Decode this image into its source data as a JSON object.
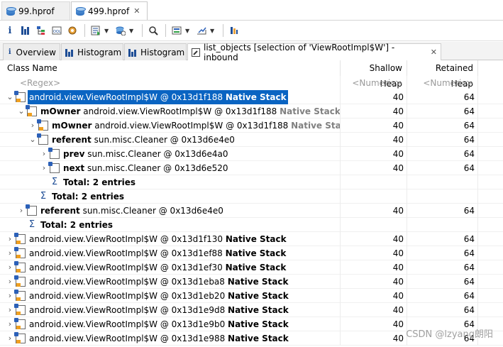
{
  "editor_tabs": [
    {
      "label": "99.hprof",
      "icon": "heap-dump-icon"
    },
    {
      "label": "499.hprof",
      "icon": "heap-dump-icon",
      "close": "✕"
    }
  ],
  "view_tabs": [
    {
      "label": "Overview",
      "icon": "info-icon"
    },
    {
      "label": "Histogram",
      "icon": "histogram-icon"
    },
    {
      "label": "Histogram",
      "icon": "histogram-icon"
    },
    {
      "label": "list_objects [selection of 'ViewRootImpl$W'] -inbound",
      "icon": "query-icon",
      "close": "✕"
    }
  ],
  "table": {
    "headers": {
      "name": "Class Name",
      "shallow": "Shallow Heap",
      "retained": "Retained Heap"
    },
    "filters": {
      "name": "<Regex>",
      "shallow": "<Numeric>",
      "retained": "<Numeric>"
    },
    "rows": [
      {
        "indent": 0,
        "twisty": "⌄",
        "icon": "object",
        "field": "",
        "cls": "android.view.ViewRootImpl$W @ 0x13d1f188",
        "native": "Native Stack",
        "shallow": "40",
        "retained": "64",
        "selected": true
      },
      {
        "indent": 1,
        "twisty": "⌄",
        "icon": "object",
        "field": "mOwner",
        "cls": "android.view.ViewRootImpl$W @ 0x13d1f188",
        "native": "Native Stack",
        "shallow": "40",
        "retained": "64"
      },
      {
        "indent": 2,
        "twisty": "›",
        "icon": "object",
        "field": "mOwner",
        "cls": "android.view.ViewRootImpl$W @ 0x13d1f188",
        "native": "Native Stack",
        "shallow": "40",
        "retained": "64"
      },
      {
        "indent": 2,
        "twisty": "⌄",
        "icon": "object",
        "field": "referent",
        "cls": "sun.misc.Cleaner @ 0x13d6e4e0",
        "native": "",
        "shallow": "40",
        "retained": "64"
      },
      {
        "indent": 3,
        "twisty": "›",
        "icon": "object",
        "field": "prev",
        "cls": "sun.misc.Cleaner @ 0x13d6e4a0",
        "native": "",
        "shallow": "40",
        "retained": "64"
      },
      {
        "indent": 3,
        "twisty": "›",
        "icon": "object",
        "field": "next",
        "cls": "sun.misc.Cleaner @ 0x13d6e520",
        "native": "",
        "shallow": "40",
        "retained": "64"
      },
      {
        "indent": 3,
        "twisty": "",
        "icon": "sigma",
        "field": "Total: 2 entries",
        "cls": "",
        "native": "",
        "shallow": "",
        "retained": ""
      },
      {
        "indent": 2,
        "twisty": "",
        "icon": "sigma",
        "field": "Total: 2 entries",
        "cls": "",
        "native": "",
        "shallow": "",
        "retained": ""
      },
      {
        "indent": 1,
        "twisty": "›",
        "icon": "object",
        "field": "referent",
        "cls": "sun.misc.Cleaner @ 0x13d6e4e0",
        "native": "",
        "shallow": "40",
        "retained": "64"
      },
      {
        "indent": 1,
        "twisty": "",
        "icon": "sigma",
        "field": "Total: 2 entries",
        "cls": "",
        "native": "",
        "shallow": "",
        "retained": ""
      },
      {
        "indent": 0,
        "twisty": "›",
        "icon": "object",
        "field": "",
        "cls": "android.view.ViewRootImpl$W @ 0x13d1f130",
        "native": "Native Stack",
        "shallow": "40",
        "retained": "64"
      },
      {
        "indent": 0,
        "twisty": "›",
        "icon": "object",
        "field": "",
        "cls": "android.view.ViewRootImpl$W @ 0x13d1ef88",
        "native": "Native Stack",
        "shallow": "40",
        "retained": "64"
      },
      {
        "indent": 0,
        "twisty": "›",
        "icon": "object",
        "field": "",
        "cls": "android.view.ViewRootImpl$W @ 0x13d1ef30",
        "native": "Native Stack",
        "shallow": "40",
        "retained": "64"
      },
      {
        "indent": 0,
        "twisty": "›",
        "icon": "object",
        "field": "",
        "cls": "android.view.ViewRootImpl$W @ 0x13d1eba8",
        "native": "Native Stack",
        "shallow": "40",
        "retained": "64"
      },
      {
        "indent": 0,
        "twisty": "›",
        "icon": "object",
        "field": "",
        "cls": "android.view.ViewRootImpl$W @ 0x13d1eb20",
        "native": "Native Stack",
        "shallow": "40",
        "retained": "64"
      },
      {
        "indent": 0,
        "twisty": "›",
        "icon": "object",
        "field": "",
        "cls": "android.view.ViewRootImpl$W @ 0x13d1e9d8",
        "native": "Native Stack",
        "shallow": "40",
        "retained": "64"
      },
      {
        "indent": 0,
        "twisty": "›",
        "icon": "object",
        "field": "",
        "cls": "android.view.ViewRootImpl$W @ 0x13d1e9b0",
        "native": "Native Stack",
        "shallow": "40",
        "retained": "64"
      },
      {
        "indent": 0,
        "twisty": "›",
        "icon": "object",
        "field": "",
        "cls": "android.view.ViewRootImpl$W @ 0x13d1e988",
        "native": "Native Stack",
        "shallow": "40",
        "retained": "64"
      }
    ]
  },
  "watermark": "CSDN @lzyang朗阳",
  "colors": {
    "selection": "#0a64c2",
    "native_stack": "#808080",
    "icon_blue": "#1f4e96"
  }
}
